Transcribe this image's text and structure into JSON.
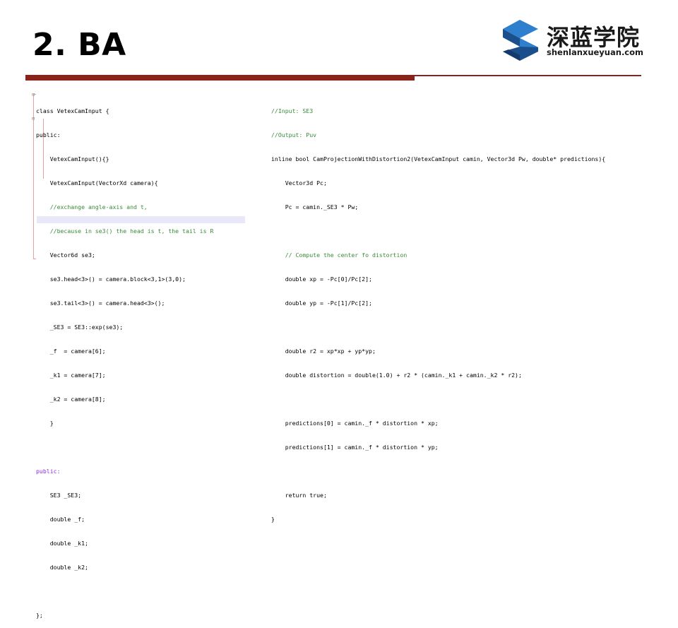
{
  "slide": {
    "title": "2. BA",
    "logo": {
      "chinese_name": "深蓝学院",
      "website": "shenlanxueyuan.com",
      "colors": {
        "dark_blue": "#1b4f8c",
        "light_blue": "#2f7fcf"
      }
    },
    "accent_color": "#8b2318"
  },
  "left_code": [
    "class VetexCamInput {",
    "public:",
    "    VetexCamInput(){}",
    "    VetexCamInput(VectorXd camera){",
    "    //exchange angle-axis and t,",
    "    //because in se3() the head is t, the tail is R",
    "    Vector6d se3;",
    "    se3.head<3>() = camera.block<3,1>(3,0);",
    "    se3.tail<3>() = camera.head<3>();",
    "    _SE3 = SE3::exp(se3);",
    "    _f  = camera[6];",
    "    _k1 = camera[7];",
    "    _k2 = camera[8];",
    "    }",
    "",
    "public:",
    "    SE3 _SE3;",
    "    double _f;",
    "    double _k1;",
    "    double _k2;",
    "",
    "};"
  ],
  "right_code": [
    "//Input: SE3",
    "//Output: Puv",
    "inline bool CamProjectionWithDistortion2(VetexCamInput camin, Vector3d Pw, double* predictions){",
    "    Vector3d Pc;",
    "    Pc = camin._SE3 * Pw;",
    "",
    "    // Compute the center fo distortion",
    "    double xp = -Pc[0]/Pc[2];",
    "    double yp = -Pc[1]/Pc[2];",
    "",
    "    double r2 = xp*xp + yp*yp;",
    "    double distortion = double(1.0) + r2 * (camin._k1 + camin._k2 * r2);",
    "",
    "    predictions[0] = camin._f * distortion * xp;",
    "    predictions[1] = camin._f * distortion * yp;",
    "",
    "    return true;",
    "}"
  ]
}
